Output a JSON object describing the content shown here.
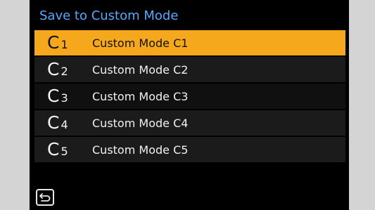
{
  "screen": {
    "title": "Save to Custom Mode"
  },
  "menu": {
    "items": [
      {
        "letter": "C",
        "number": "1",
        "label": "Custom Mode C1",
        "selected": true
      },
      {
        "letter": "C",
        "number": "2",
        "label": "Custom Mode C2",
        "selected": false
      },
      {
        "letter": "C",
        "number": "3",
        "label": "Custom Mode C3",
        "selected": false
      },
      {
        "letter": "C",
        "number": "4",
        "label": "Custom Mode C4",
        "selected": false
      },
      {
        "letter": "C",
        "number": "5",
        "label": "Custom Mode C5",
        "selected": false
      }
    ]
  },
  "colors": {
    "title": "#5aa7ff",
    "selected_row": "#f5a81c",
    "row": "#1b1b1b",
    "background": "#000000"
  },
  "icons": {
    "back": "return-arrow-icon"
  }
}
